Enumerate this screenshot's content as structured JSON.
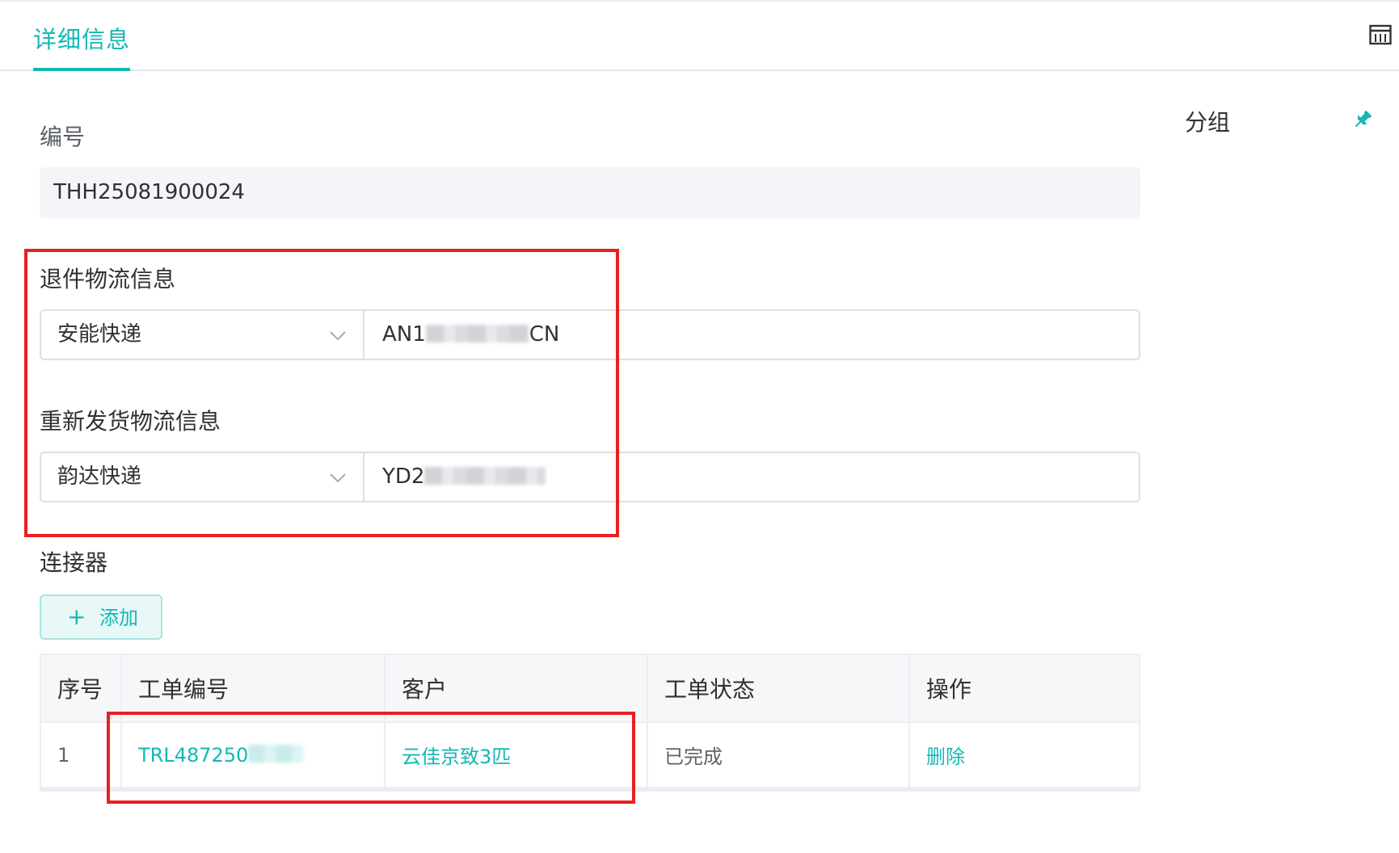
{
  "tabs": [
    {
      "label": "详细信息",
      "active": true
    }
  ],
  "toolbar": {
    "layout_icon": "layout-grid-icon"
  },
  "form": {
    "number_label": "编号",
    "number_value": "THH25081900024",
    "return_logistics": {
      "label": "退件物流信息",
      "carrier": "安能快递",
      "tracking_visible": "AN1",
      "tracking_suffix": "CN"
    },
    "reship_logistics": {
      "label": "重新发货物流信息",
      "carrier": "韵达快递",
      "tracking_visible": "YD2"
    },
    "connector": {
      "label": "连接器",
      "add_button": "添加",
      "table": {
        "columns": [
          "序号",
          "工单编号",
          "客户",
          "工单状态",
          "操作"
        ],
        "rows": [
          {
            "index": "1",
            "order_no": "TRL487250",
            "customer": "云佳京致3匹",
            "status": "已完成",
            "action": "删除"
          }
        ]
      }
    }
  },
  "side_panel": {
    "title": "分组",
    "pin_icon": "pin-icon"
  },
  "colors": {
    "accent": "#13b8b4",
    "highlight": "#e8201e"
  }
}
